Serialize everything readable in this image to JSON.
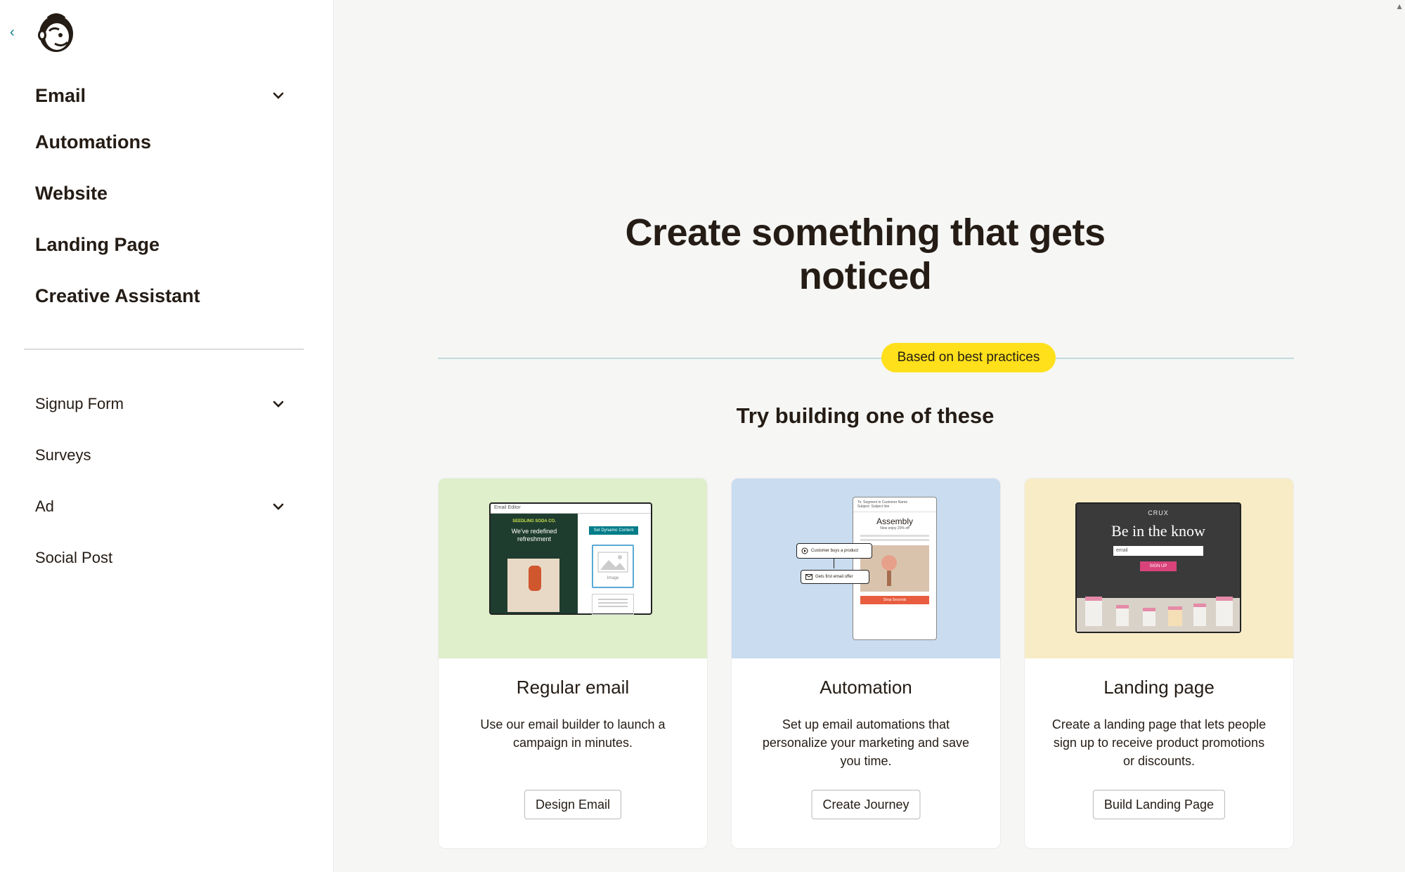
{
  "sidebar": {
    "back_label": "‹",
    "primary": [
      {
        "label": "Email",
        "expandable": true
      },
      {
        "label": "Automations",
        "expandable": false
      },
      {
        "label": "Website",
        "expandable": false
      },
      {
        "label": "Landing Page",
        "expandable": false
      },
      {
        "label": "Creative Assistant",
        "expandable": false
      }
    ],
    "secondary": [
      {
        "label": "Signup Form",
        "expandable": true
      },
      {
        "label": "Surveys",
        "expandable": false
      },
      {
        "label": "Ad",
        "expandable": true
      },
      {
        "label": "Social Post",
        "expandable": false
      }
    ]
  },
  "main": {
    "headline": "Create something that gets noticed",
    "badge": "Based on best practices",
    "subhead": "Try building one of these",
    "cards": [
      {
        "title": "Regular email",
        "description": "Use our email builder to launch a campaign in minutes.",
        "button": "Design Email",
        "bg_color": "#dfeecb",
        "media": {
          "editor_label": "Email Editor",
          "brand": "SEEDLING SODA CO.",
          "headline": "We've redefined refreshment",
          "chip": "Set Dynamic Content",
          "image_label": "Image",
          "text_label": "Text"
        }
      },
      {
        "title": "Automation",
        "description": "Set up email automations that personalize your marketing and save you time.",
        "button": "Create Journey",
        "bg_color": "#c9dcf0",
        "media": {
          "meta_line_1": "To: Segment in Customer Name",
          "meta_line_2": "Subject: Subject line",
          "brand": "Assembly",
          "offer": "Now enjoy 20% off",
          "step_1": "Customer buys a product",
          "step_2": "Gets first email offer",
          "cta": "Shop Seconds"
        }
      },
      {
        "title": "Landing page",
        "description": "Create a landing page that lets people sign up to receive product promotions or discounts.",
        "button": "Build Landing Page",
        "bg_color": "#f7ecc6",
        "media": {
          "brand": "CRUX",
          "headline": "Be in the know",
          "input_placeholder": "email",
          "cta": "SIGN UP"
        }
      }
    ]
  },
  "colors": {
    "accent_yellow": "#ffe01b",
    "back_arrow": "#007c89",
    "text": "#241c15"
  }
}
